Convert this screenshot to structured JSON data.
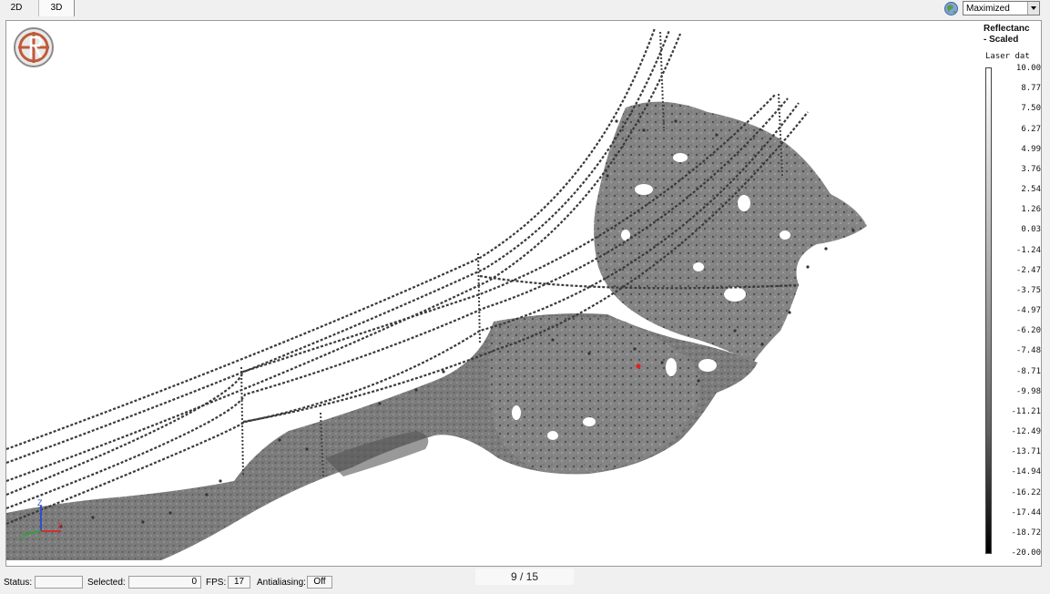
{
  "tabs": [
    {
      "label": "2D",
      "active": false
    },
    {
      "label": "3D",
      "active": true
    }
  ],
  "window_mode": {
    "selected": "Maximized"
  },
  "icons": {
    "globe": "globe-icon",
    "logo": "app-logo-icon",
    "axes": "xyz-axes-icon",
    "dropdown": "chevron-down-icon"
  },
  "axes_labels": {
    "x": "X",
    "y": "Y",
    "z": "Z"
  },
  "legend": {
    "title_line1": "Reflectanc",
    "title_line2": "- Scaled",
    "subtitle": "Laser dat",
    "ticks": [
      "10.00",
      "8.77",
      "7.50",
      "6.27",
      "4.99",
      "3.76",
      "2.54",
      "1.26",
      "0.03",
      "-1.24",
      "-2.47",
      "-3.75",
      "-4.97",
      "-6.20",
      "-7.48",
      "-8.71",
      "-9.98",
      "-11.21",
      "-12.49",
      "-13.71",
      "-14.94",
      "-16.22",
      "-17.44",
      "-18.72",
      "-20.00"
    ]
  },
  "status": {
    "status_label": "Status:",
    "status_value": "",
    "selected_label": "Selected:",
    "selected_value": "0",
    "fps_label": "FPS:",
    "fps_value": "17",
    "antialiasing_label": "Antialiasing:",
    "antialiasing_value": "Off"
  },
  "page_indicator": "9 / 15",
  "colors": {
    "accent_marker": "#e02020",
    "point_dark": "#3a3a3a",
    "terrain": "#7a7a7a"
  }
}
